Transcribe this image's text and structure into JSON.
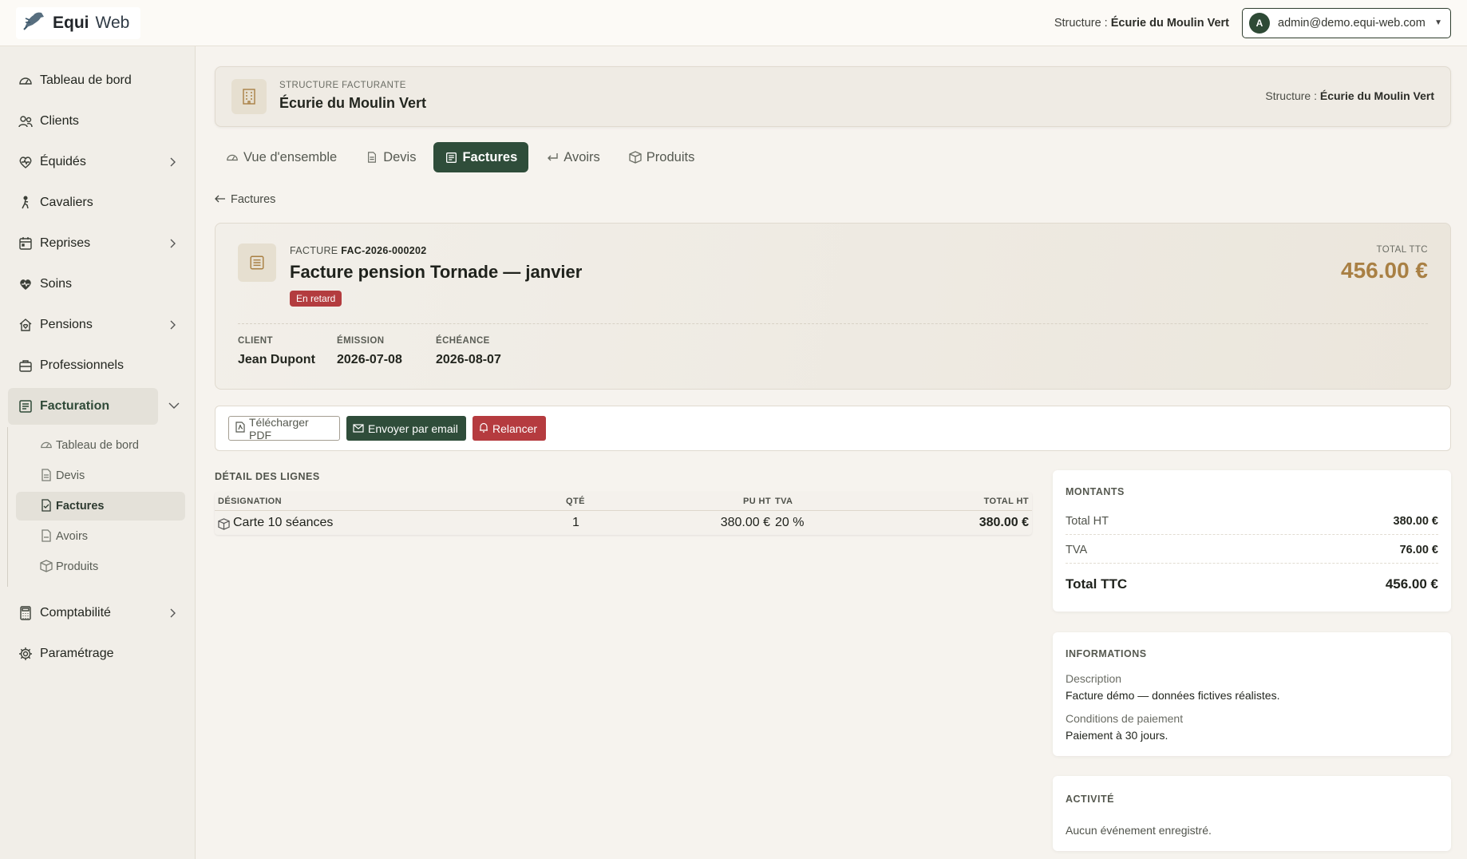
{
  "header": {
    "brand_name": "Equi",
    "brand_sub": "Web",
    "structure_prefix": "Structure : ",
    "structure_name": "Écurie du Moulin Vert",
    "user_initial": "A",
    "user_email": "admin@demo.equi-web.com"
  },
  "sidebar": {
    "items": [
      {
        "label": "Tableau de bord",
        "icon": "dashboard-icon"
      },
      {
        "label": "Clients",
        "icon": "users-icon"
      },
      {
        "label": "Équidés",
        "icon": "horse-heart-icon"
      },
      {
        "label": "Cavaliers",
        "icon": "rider-icon"
      },
      {
        "label": "Reprises",
        "icon": "calendar-icon"
      },
      {
        "label": "Soins",
        "icon": "heart-pulse-icon"
      },
      {
        "label": "Pensions",
        "icon": "house-icon"
      },
      {
        "label": "Professionnels",
        "icon": "briefcase-icon"
      },
      {
        "label": "Facturation",
        "icon": "receipt-icon"
      },
      {
        "label": "Comptabilité",
        "icon": "calculator-icon"
      },
      {
        "label": "Paramétrage",
        "icon": "gear-icon"
      }
    ],
    "sub_items": [
      {
        "label": "Tableau de bord"
      },
      {
        "label": "Devis"
      },
      {
        "label": "Factures"
      },
      {
        "label": "Avoirs"
      },
      {
        "label": "Produits"
      }
    ]
  },
  "structure_card": {
    "kicker": "STRUCTURE FACTURANTE",
    "title": "Écurie du Moulin Vert",
    "right_prefix": "Structure : ",
    "right_name": "Écurie du Moulin Vert"
  },
  "tabs": [
    {
      "label": "Vue d'ensemble"
    },
    {
      "label": "Devis"
    },
    {
      "label": "Factures"
    },
    {
      "label": "Avoirs"
    },
    {
      "label": "Produits"
    }
  ],
  "back_label": "Factures",
  "invoice": {
    "kicker": "FACTURE",
    "number": "FAC-2026-000202",
    "title": "Facture pension Tornade — janvier",
    "status": "En retard",
    "total_label": "TOTAL TTC",
    "total_value": "456.00 €",
    "meta": [
      {
        "key": "CLIENT",
        "value": "Jean Dupont"
      },
      {
        "key": "ÉMISSION",
        "value": "2026-07-08"
      },
      {
        "key": "ÉCHÉANCE",
        "value": "2026-08-07"
      }
    ]
  },
  "actions": {
    "pdf": "Télécharger PDF",
    "email": "Envoyer par email",
    "remind": "Relancer"
  },
  "lines": {
    "title": "DÉTAIL DES LIGNES",
    "headers": {
      "designation": "DÉSIGNATION",
      "qty": "QTÉ",
      "pu": "PU HT",
      "tva": "TVA",
      "total": "TOTAL HT"
    },
    "rows": [
      {
        "designation": "Carte 10 séances",
        "qty": "1",
        "pu": "380.00 €",
        "tva": "20 %",
        "total": "380.00 €"
      }
    ]
  },
  "amounts": {
    "title": "MONTANTS",
    "ht_label": "Total HT",
    "ht_value": "380.00 €",
    "tva_label": "TVA",
    "tva_value": "76.00 €",
    "ttc_label": "Total TTC",
    "ttc_value": "456.00 €"
  },
  "informations": {
    "title": "INFORMATIONS",
    "desc_label": "Description",
    "desc_value": "Facture démo — données fictives réalistes.",
    "cond_label": "Conditions de paiement",
    "cond_value": "Paiement à 30 jours."
  },
  "activity": {
    "title": "ACTIVITÉ",
    "empty": "Aucun événement enregistré."
  },
  "colors": {
    "primary_green": "#2f4d3a",
    "danger_red": "#b33c3f",
    "gold": "#a98044"
  }
}
